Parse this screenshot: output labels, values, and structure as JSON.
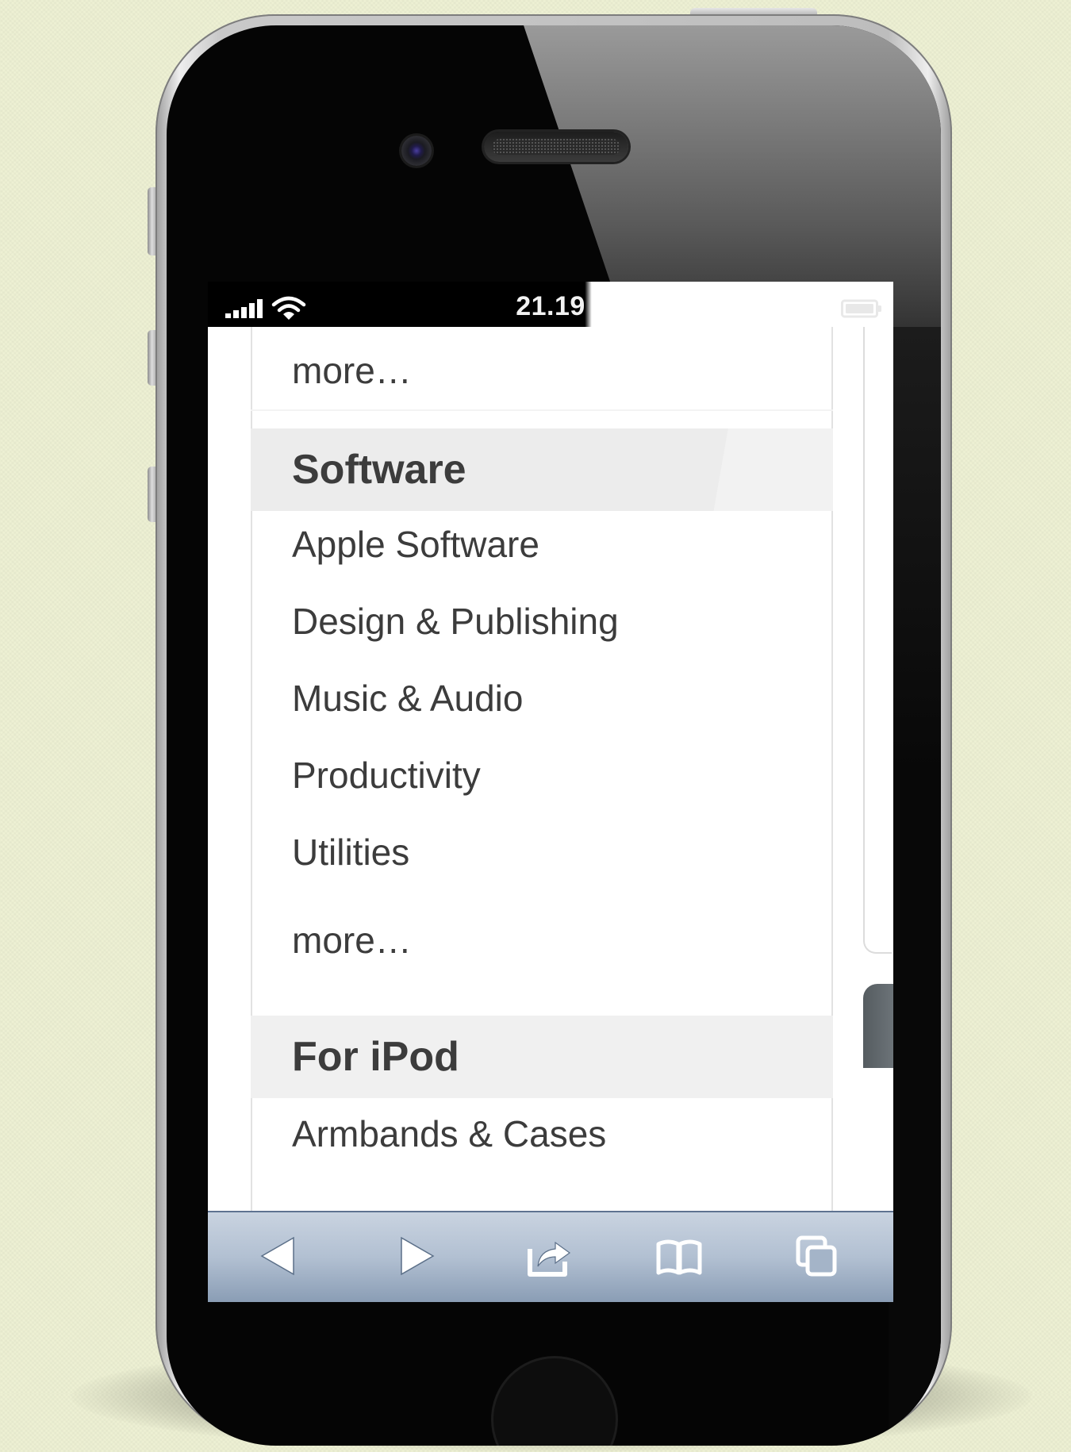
{
  "status_bar": {
    "time": "21.19",
    "signal_icon": "cellular-signal-icon",
    "wifi_icon": "wifi-icon",
    "battery_icon": "battery-icon"
  },
  "menu": {
    "top_more": "more…",
    "sections": [
      {
        "title": "Software",
        "items": [
          "Apple Software",
          "Design & Publishing",
          "Music & Audio",
          "Productivity",
          "Utilities"
        ],
        "more": "more…"
      },
      {
        "title": "For iPod",
        "items": [
          "Armbands & Cases"
        ]
      }
    ]
  },
  "toolbar": {
    "buttons": [
      "back-arrow-icon",
      "forward-arrow-icon",
      "share-icon",
      "bookmarks-icon",
      "tabs-icon"
    ]
  },
  "colors": {
    "page_background": "#eef1d4",
    "section_header_bg": "#f0f0f0",
    "text": "#3c3c3c",
    "toolbar_top": "#c9d3e0",
    "toolbar_bottom": "#8a9db5"
  }
}
